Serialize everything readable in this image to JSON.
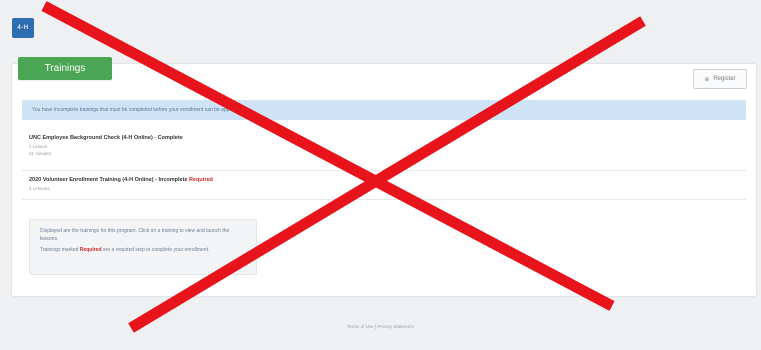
{
  "header": {
    "logo_text": "4-H"
  },
  "tabs": {
    "trainings_label": "Trainings"
  },
  "toolbar": {
    "register_label": "Register",
    "register_icon": "plus-circle-icon"
  },
  "alert": {
    "text": "You have incomplete trainings that must be completed before your enrollment can be approved."
  },
  "trainings": [
    {
      "title": "UNC Employee Background Check (4-H Online) - Complete",
      "subtitle_1": "1 Lesson",
      "subtitle_2": "21 minutes",
      "required_label": ""
    },
    {
      "title": "2020 Volunteer Enrollment Training (4-H Online) - Incomplete",
      "subtitle_1": "3 Lessons",
      "subtitle_2": "",
      "required_label": "Required"
    }
  ],
  "info": {
    "line_1": "Displayed are the trainings for this program. Click on a training to view and launch the lessons.",
    "line_2_prefix": "Trainings marked",
    "line_2_required": "Required",
    "line_2_suffix": "are a required step to complete your enrollment."
  },
  "footer": {
    "text": "Terms of Use | Privacy Statement"
  },
  "colors": {
    "accent_green": "#4aa654",
    "logo_blue": "#2f6db3",
    "alert_blue": "#cfe3f6",
    "required_red": "#c62828",
    "cross_red": "#e8141b"
  }
}
